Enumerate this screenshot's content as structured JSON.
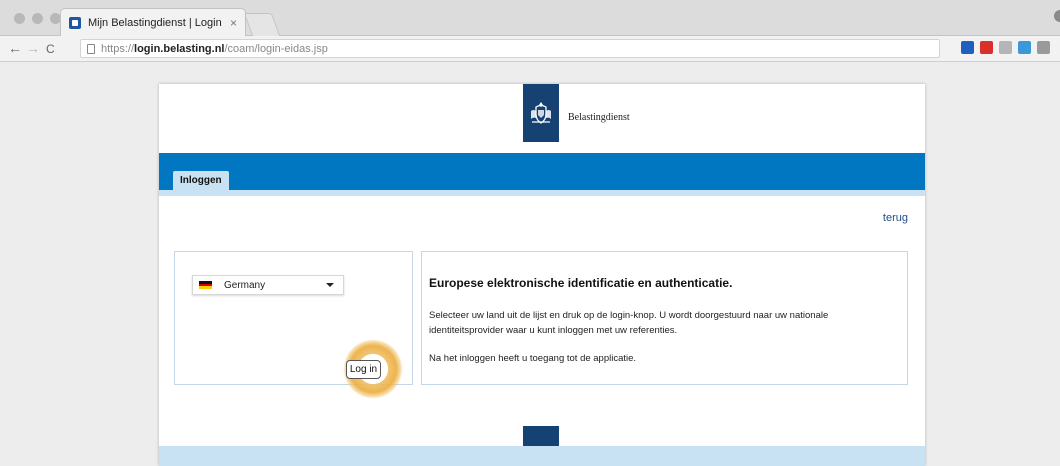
{
  "browser": {
    "tab_title": "Mijn Belastingdienst | Login",
    "tab_close": "×",
    "back": "←",
    "forward": "→",
    "reload": "C",
    "url_prefix": "https://",
    "url_host": "login.belasting.nl",
    "url_path": "/coam/login-eidas.jsp",
    "extension_colors": [
      "#1f5fbf",
      "#d9302c",
      "#b5b5b5",
      "#3a9ad9",
      "#9a9a9a"
    ]
  },
  "header": {
    "logo_text": "Belastingdienst",
    "brand_color": "#154273"
  },
  "nav": {
    "tab_label": "Inloggen",
    "bar_color": "#0077c0"
  },
  "back_link": "terug",
  "country_select": {
    "selected": "Germany"
  },
  "login_button": "Log in",
  "info": {
    "title": "Europese elektronische identificatie en authenticatie.",
    "paragraph1": "Selecteer uw land uit de lijst en druk op de login-knop. U wordt doorgestuurd naar uw nationale identiteitsprovider waar u kunt inloggen met uw referenties.",
    "paragraph2": "Na het inloggen heeft u toegang tot de applicatie."
  }
}
